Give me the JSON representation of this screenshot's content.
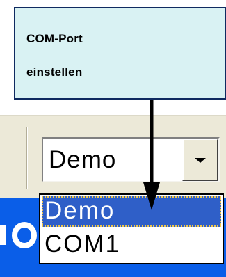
{
  "callout": {
    "line1": "COM-Port",
    "line2": "einstellen"
  },
  "combo": {
    "selected_value": "Demo",
    "button_icon": "chevron-down-icon"
  },
  "dropdown": {
    "items": [
      {
        "label": "Demo",
        "selected": true
      },
      {
        "label": "COM1",
        "selected": false
      }
    ]
  },
  "colors": {
    "callout_bg": "#d9f2f3",
    "callout_border": "#0f2a60",
    "toolbar_bg": "#ece9d8",
    "desktop_blue": "#0a5ee8",
    "selection_blue": "#2f5fc8",
    "focus_dots": "#f2c94c"
  }
}
